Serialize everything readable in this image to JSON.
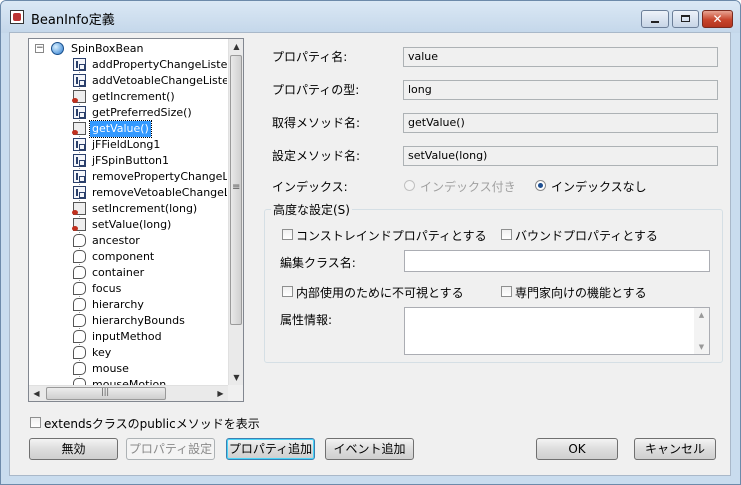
{
  "window": {
    "title": "BeanInfo定義"
  },
  "tree": {
    "root": "SpinBoxBean",
    "items": [
      {
        "label": "addPropertyChangeListe",
        "icon": "method-icon"
      },
      {
        "label": "addVetoableChangeListe",
        "icon": "method-icon"
      },
      {
        "label": "getIncrement()",
        "icon": "getter-icon"
      },
      {
        "label": "getPreferredSize()",
        "icon": "method-icon"
      },
      {
        "label": "getValue()",
        "icon": "getter-icon",
        "selected": true
      },
      {
        "label": "jFFieldLong1",
        "icon": "method-icon"
      },
      {
        "label": "jFSpinButton1",
        "icon": "method-icon"
      },
      {
        "label": "removePropertyChangeL",
        "icon": "method-icon"
      },
      {
        "label": "removeVetoableChangeL",
        "icon": "method-icon"
      },
      {
        "label": "setIncrement(long)",
        "icon": "getter-icon"
      },
      {
        "label": "setValue(long)",
        "icon": "getter-icon"
      },
      {
        "label": "ancestor",
        "icon": "event-icon"
      },
      {
        "label": "component",
        "icon": "event-icon"
      },
      {
        "label": "container",
        "icon": "event-icon"
      },
      {
        "label": "focus",
        "icon": "event-icon"
      },
      {
        "label": "hierarchy",
        "icon": "event-icon"
      },
      {
        "label": "hierarchyBounds",
        "icon": "event-icon"
      },
      {
        "label": "inputMethod",
        "icon": "event-icon"
      },
      {
        "label": "key",
        "icon": "event-icon"
      },
      {
        "label": "mouse",
        "icon": "event-icon"
      },
      {
        "label": "mouseMotion",
        "icon": "event-icon"
      }
    ]
  },
  "form": {
    "property_name_label": "プロパティ名:",
    "property_name_value": "value",
    "property_type_label": "プロパティの型:",
    "property_type_value": "long",
    "getter_label": "取得メソッド名:",
    "getter_value": "getValue()",
    "setter_label": "設定メソッド名:",
    "setter_value": "setValue(long)",
    "index_label": "インデックス:",
    "index_with_label": "インデックス付き",
    "index_without_label": "インデックスなし",
    "index_selected": "インデックスなし"
  },
  "advanced": {
    "title": "高度な設定(S)",
    "constrained_label": "コンストレインドプロパティとする",
    "constrained_checked": false,
    "bound_label": "バウンドプロパティとする",
    "bound_checked": false,
    "editor_class_label": "編集クラス名:",
    "editor_class_value": "",
    "hidden_label": "内部使用のために不可視とする",
    "hidden_checked": false,
    "expert_label": "専門家向けの機能とする",
    "expert_checked": false,
    "attributes_label": "属性情報:",
    "attributes_value": ""
  },
  "extends_checkbox": {
    "label": "extendsクラスのpublicメソッドを表示",
    "checked": false
  },
  "buttons": {
    "disable": "無効",
    "property_settings": "プロパティ設定",
    "add_property": "プロパティ追加",
    "add_event": "イベント追加",
    "ok": "OK",
    "cancel": "キャンセル"
  }
}
